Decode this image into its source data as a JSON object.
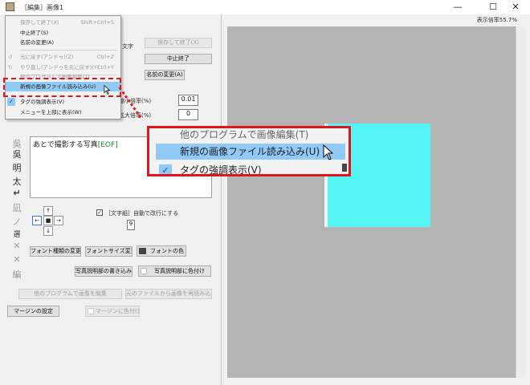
{
  "window": {
    "title": "［編集］画像1",
    "minimize": "—",
    "maximize": "☐",
    "close": "✕"
  },
  "zoom_label": "表示倍率55.7%",
  "menu": {
    "items": [
      {
        "label": "保存して終了(X)",
        "shortcut": "Shift+Ctrl+S",
        "disabled": true
      },
      {
        "label": "中止終了(S)",
        "shortcut": "",
        "disabled": false
      },
      {
        "label": "名前の変更(A)",
        "shortcut": "",
        "disabled": false
      },
      {
        "label": "元に戻す(アンドゥ)(Z)",
        "shortcut": "Ctrl+Z",
        "disabled": true
      },
      {
        "label": "やり直し(アンドゥを元に戻す)(Y)",
        "shortcut": "Ctrl+Y",
        "disabled": true
      },
      {
        "label": "他のプログラムで画像編集(T)",
        "shortcut": "",
        "disabled": false
      },
      {
        "label": "新規の画像ファイル読み込み(U)",
        "shortcut": "",
        "disabled": false
      },
      {
        "label": "タグの強調表示(V)",
        "shortcut": "",
        "disabled": false
      },
      {
        "label": "メニューを上部に表示(W)",
        "shortcut": "",
        "disabled": false
      }
    ]
  },
  "callout": {
    "items": [
      {
        "label": "他のプログラムで画像編集(T)"
      },
      {
        "label": "新規の画像ファイル読み込み(U)"
      },
      {
        "label": "タグの強調表示(V)"
      }
    ]
  },
  "right_panel": {
    "text_label": "文字",
    "save_exit": "保存して終了(X)",
    "abort_exit": "中止終了",
    "rename": "名前の変更(A)",
    "shrink_label": "縮小倍率(%)",
    "shrink_value": "0.01",
    "enlarge_label": "拡大倍率(%)",
    "enlarge_value": "0"
  },
  "editor": {
    "text": "あとで撮影する写真",
    "eof": "[EOF]"
  },
  "tools": [
    "吳",
    "明",
    "太",
    "↵",
    "凪",
    "ノ",
    "選",
    "✕",
    "✕",
    "編"
  ],
  "arrows": {
    "up": "↑",
    "left": "←",
    "center": "■",
    "right": "→",
    "down": "↓"
  },
  "auto_wrap": {
    "label": "［文字組］自動で改行にする",
    "checked": true,
    "value": "9"
  },
  "buttons": {
    "font_type": "フォント種類の変更",
    "font_size": "フォントサイズ変更",
    "font_color": "フォントの色",
    "caption_write": "写真説明部の書き込み",
    "caption_color": "写真説明部に色付け",
    "other_program": "他のプログラムで画像を編集",
    "reload": "元のファイルから画像を再読み込み",
    "margin_set": "マージンの設定",
    "margin_color": "マージンに色付け"
  },
  "colors": {
    "canvas_bg": "#b4b4b4",
    "image": "#55f5f5",
    "highlight": "#91c9f7",
    "accent_red": "#e0161e"
  }
}
